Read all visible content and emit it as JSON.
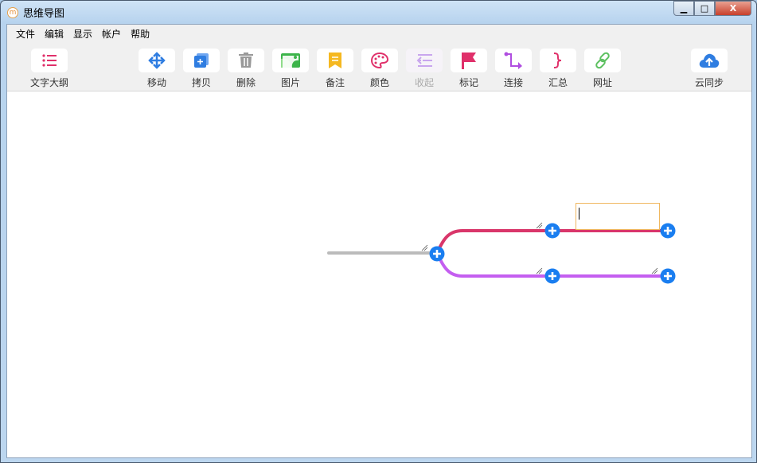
{
  "window": {
    "title": "思维导图",
    "app_icon": "m",
    "controls": {
      "minimize": "▁",
      "maximize": "□",
      "close": "X"
    }
  },
  "menu": [
    "文件",
    "编辑",
    "显示",
    "帐户",
    "帮助"
  ],
  "toolbar": [
    {
      "label": "文字大纲",
      "icon": "list-icon",
      "color": "#e0306a"
    },
    {
      "label": "移动",
      "icon": "move-icon",
      "color": "#2f7de1"
    },
    {
      "label": "拷贝",
      "icon": "copy-icon",
      "color": "#2f7de1"
    },
    {
      "label": "删除",
      "icon": "trash-icon",
      "color": "#999999"
    },
    {
      "label": "图片",
      "icon": "image-icon",
      "color": "#3cb44a"
    },
    {
      "label": "备注",
      "icon": "note-icon",
      "color": "#f5b820"
    },
    {
      "label": "颜色",
      "icon": "palette-icon",
      "color": "#e0306a"
    },
    {
      "label": "收起",
      "icon": "collapse-icon",
      "color": "#c9a6ee",
      "disabled": true
    },
    {
      "label": "标记",
      "icon": "flag-icon",
      "color": "#e0306a"
    },
    {
      "label": "连接",
      "icon": "connect-icon",
      "color": "#b04ee0"
    },
    {
      "label": "汇总",
      "icon": "brace-icon",
      "color": "#e0306a"
    },
    {
      "label": "网址",
      "icon": "link-icon",
      "color": "#5cc060"
    },
    {
      "label": "云同步",
      "icon": "cloud-upload-icon",
      "color": "#2f7de1"
    }
  ],
  "mindmap": {
    "colors": {
      "root": "#bbbbbb",
      "branch1": "#d9366a",
      "branch2": "#c45ef0",
      "node_button": "#1a7ef0",
      "edit_border": "#f0b860"
    },
    "edit_value": ""
  }
}
